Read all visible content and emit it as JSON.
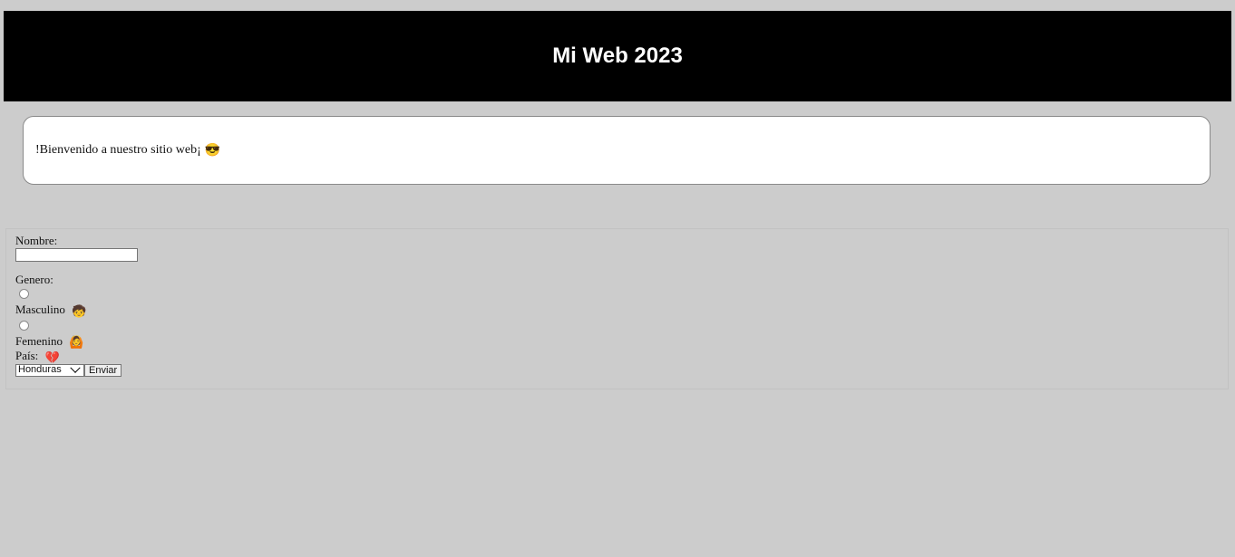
{
  "header": {
    "title": "Mi Web 2023"
  },
  "welcome": {
    "text": "!Bienvenido a nuestro sitio web¡",
    "emoji": "😎"
  },
  "form": {
    "name_label": "Nombre:",
    "name_value": "",
    "gender_label": "Genero:",
    "gender_options": [
      {
        "label": "Masculino",
        "emoji": "🧒",
        "checked": false
      },
      {
        "label": "Femenino",
        "emoji": "🙆",
        "checked": false
      }
    ],
    "country_label": "País:",
    "country_emoji": "💔",
    "country_selected": "Honduras",
    "submit_label": "Enviar"
  }
}
